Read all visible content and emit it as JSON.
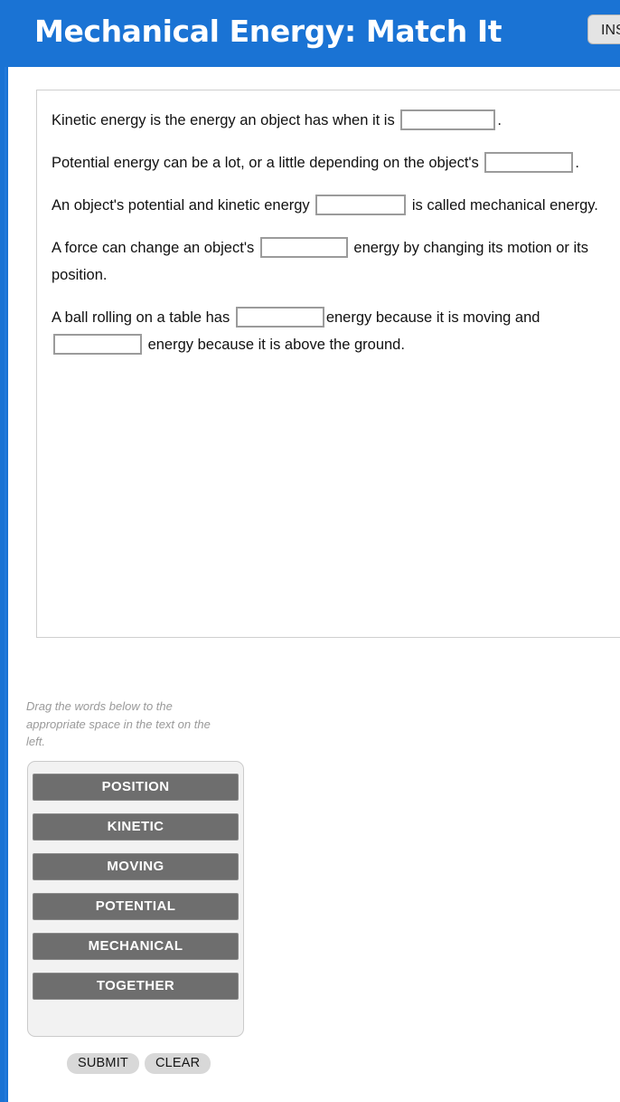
{
  "header": {
    "title": "Mechanical Energy: Match It",
    "instructions_button": "INSTRUCTIONS"
  },
  "exercise": {
    "sentences": [
      {
        "parts": [
          {
            "type": "text",
            "value": "Kinetic energy is the energy an object has when it is "
          },
          {
            "type": "blank",
            "width": "w105"
          },
          {
            "type": "text",
            "value": "."
          }
        ]
      },
      {
        "parts": [
          {
            "type": "text",
            "value": "Potential energy can be a lot, or a little depending on the object's "
          },
          {
            "type": "blank",
            "width": "w98"
          },
          {
            "type": "text",
            "value": "."
          }
        ]
      },
      {
        "parts": [
          {
            "type": "text",
            "value": "An object's potential and kinetic energy "
          },
          {
            "type": "blank",
            "width": "w100"
          },
          {
            "type": "text",
            "value": " is called mechanical energy."
          }
        ]
      },
      {
        "parts": [
          {
            "type": "text",
            "value": "A force can change an object's "
          },
          {
            "type": "blank",
            "width": "w97"
          },
          {
            "type": "text",
            "value": " energy by changing its motion or its position."
          }
        ]
      },
      {
        "parts": [
          {
            "type": "text",
            "value": "A ball rolling on a table has "
          },
          {
            "type": "blank",
            "width": "w98"
          },
          {
            "type": "text",
            "value": "energy because it is moving and "
          },
          {
            "type": "blank",
            "width": "w98"
          },
          {
            "type": "text",
            "value": " energy because it is above the ground."
          }
        ]
      }
    ]
  },
  "drag_instructions": "Drag the words below to the appropriate space in the text on the left.",
  "word_bank": {
    "tiles": [
      {
        "label": "POSITION"
      },
      {
        "label": "KINETIC"
      },
      {
        "label": "MOVING"
      },
      {
        "label": "POTENTIAL"
      },
      {
        "label": "MECHANICAL"
      },
      {
        "label": "TOGETHER"
      }
    ]
  },
  "actions": {
    "submit_label": "SUBMIT",
    "clear_label": "CLEAR"
  },
  "colors": {
    "header_blue": "#1a73d4",
    "tile_gray": "#6e6e6e",
    "panel_bg": "#f2f2f2",
    "button_gray": "#d8d8d8",
    "instruction_text": "#9a9a9a"
  }
}
